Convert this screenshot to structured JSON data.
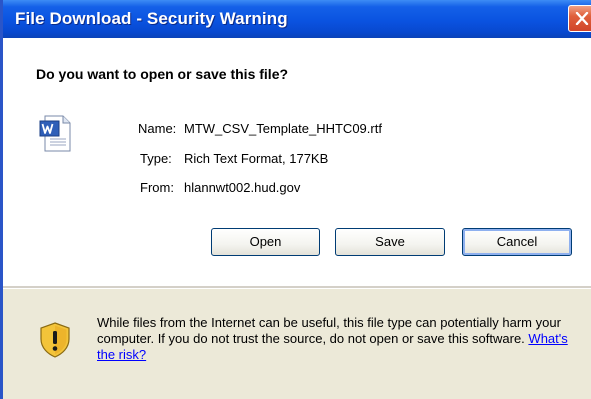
{
  "window": {
    "title": "File Download - Security Warning"
  },
  "dialog": {
    "question": "Do you want to open or save this file?",
    "file": {
      "icon": "word-document-icon",
      "name_label": "Name:",
      "name_value": "MTW_CSV_Template_HHTC09.rtf",
      "type_label": "Type:",
      "type_value": "Rich Text Format, 177KB",
      "from_label": "From:",
      "from_value": "hlannwt002.hud.gov"
    },
    "buttons": {
      "open": "Open",
      "save": "Save",
      "cancel": "Cancel"
    },
    "warning": {
      "icon": "security-shield-icon",
      "text": "While files from the Internet can be useful, this file type can potentially harm your computer. If you do not trust the source, do not open or save this software.",
      "link": "What's the risk?"
    }
  },
  "colors": {
    "titlebar": "#0a53e0",
    "dialog_bg": "#ece9d8",
    "close_button": "#d1452a",
    "link": "#0000ff"
  }
}
